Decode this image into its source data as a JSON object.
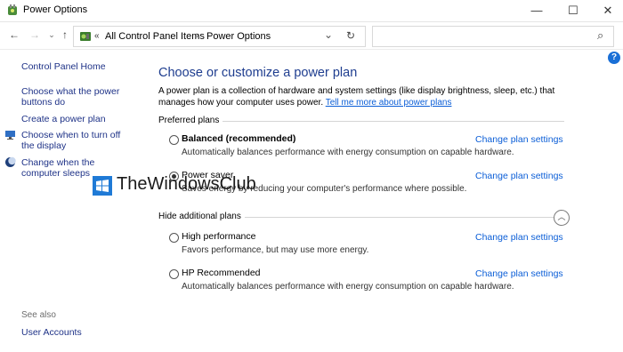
{
  "window": {
    "title": "Power Options",
    "icon": "power-options-icon",
    "controls": {
      "minimize": "—",
      "maximize": "☐",
      "close": "✕"
    }
  },
  "address": {
    "chevrons": "«",
    "crumbs": [
      "All Control Panel Items",
      "Power Options"
    ],
    "separator": "›",
    "dropdown": "⌄",
    "refresh": "↻",
    "search_placeholder": "",
    "search_icon": "⌕"
  },
  "sidebar": {
    "home": "Control Panel Home",
    "links": [
      "Choose what the power buttons do",
      "Create a power plan",
      "Choose when to turn off the display",
      "Change when the computer sleeps"
    ],
    "see_also": "See also",
    "see_also_links": [
      "User Accounts"
    ]
  },
  "main": {
    "heading": "Choose or customize a power plan",
    "intro": "A power plan is a collection of hardware and system settings (like display brightness, sleep, etc.) that manages how your computer uses power.",
    "intro_link": "Tell me more about power plans",
    "preferred_label": "Preferred plans",
    "hidden_label": "Hide additional plans",
    "change_label": "Change plan settings",
    "plans": [
      {
        "name": "Balanced (recommended)",
        "desc": "Automatically balances performance with energy consumption on capable hardware.",
        "selected": false
      },
      {
        "name": "Power saver",
        "desc": "Saves energy by reducing your computer's performance where possible.",
        "selected": true
      },
      {
        "name": "High performance",
        "desc": "Favors performance, but may use more energy.",
        "selected": false
      },
      {
        "name": "HP Recommended",
        "desc": "Automatically balances performance with energy consumption on capable hardware.",
        "selected": false
      }
    ],
    "help": "?"
  },
  "watermark": {
    "text": "TheWindowsClub"
  },
  "colors": {
    "link": "#0b5ed7",
    "heading": "#1e3d8f",
    "accent": "#1a6fd6"
  }
}
